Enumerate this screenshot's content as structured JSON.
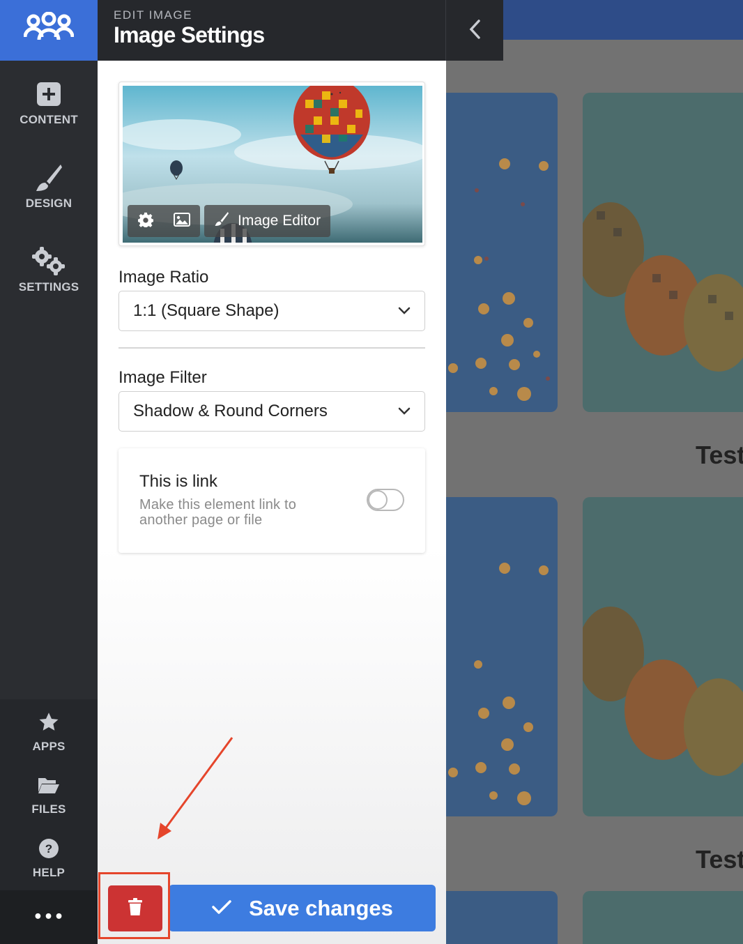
{
  "rail": {
    "items": [
      {
        "label": "CONTENT",
        "icon": "plus-square-icon"
      },
      {
        "label": "DESIGN",
        "icon": "paintbrush-icon"
      },
      {
        "label": "SETTINGS",
        "icon": "gears-icon"
      }
    ],
    "bottom_items": [
      {
        "label": "APPS",
        "icon": "star-icon"
      },
      {
        "label": "FILES",
        "icon": "folder-open-icon"
      },
      {
        "label": "HELP",
        "icon": "question-circle-icon"
      }
    ],
    "more_label": "•••"
  },
  "header": {
    "kicker": "EDIT IMAGE",
    "title": "Image Settings"
  },
  "preview": {
    "editor_label": "Image Editor"
  },
  "image_ratio": {
    "label": "Image Ratio",
    "value": "1:1 (Square Shape)"
  },
  "image_filter": {
    "label": "Image Filter",
    "value": "Shadow & Round Corners"
  },
  "link": {
    "title": "This is link",
    "description": "Make this element link to another page or file",
    "enabled": false
  },
  "footer": {
    "save_label": "Save changes"
  },
  "canvas": {
    "captions": [
      "Test",
      "Test"
    ]
  },
  "colors": {
    "brand": "#3b6fd8",
    "save": "#3d7ce0",
    "delete": "#cc3333",
    "annotation": "#e5452b"
  }
}
